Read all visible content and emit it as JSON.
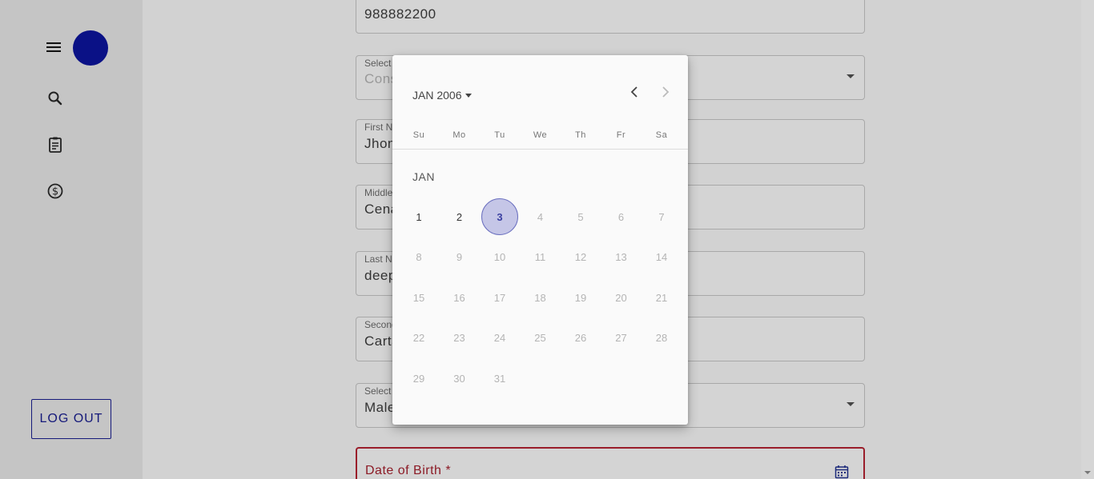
{
  "sidebar": {
    "icons": [
      "menu-icon",
      "search-icon",
      "clipboard-icon",
      "dollar-icon"
    ],
    "logout_label": "LOG OUT"
  },
  "form": {
    "phone_value": "988882200",
    "credit_line": {
      "label": "Select credit line type",
      "value": "Consumer credit line"
    },
    "first_name": {
      "label": "First Name *",
      "value": "Jhon"
    },
    "middle_name": {
      "label": "Middle Name",
      "value": "Cena"
    },
    "last_name": {
      "label": "Last Name",
      "value": "deep"
    },
    "second_last_name": {
      "label": "Second Last Name",
      "value": "Cartagena"
    },
    "gender": {
      "label": "Select your gender",
      "value": "Male"
    },
    "dob": {
      "label": "Date of Birth *"
    }
  },
  "datepicker": {
    "month_year": "JAN 2006",
    "weekdays": [
      "Su",
      "Mo",
      "Tu",
      "We",
      "Th",
      "Fr",
      "Sa"
    ],
    "month_label": "JAN",
    "selected_day": 3,
    "enabled_days": [
      1,
      2,
      3
    ],
    "days": [
      1,
      2,
      3,
      4,
      5,
      6,
      7,
      8,
      9,
      10,
      11,
      12,
      13,
      14,
      15,
      16,
      17,
      18,
      19,
      20,
      21,
      22,
      23,
      24,
      25,
      26,
      27,
      28,
      29,
      30,
      31
    ],
    "first_weekday": 0
  },
  "colors": {
    "accent": "#0a1186",
    "error": "#9a1d2a",
    "selected_bg": "#c5c6e7"
  }
}
